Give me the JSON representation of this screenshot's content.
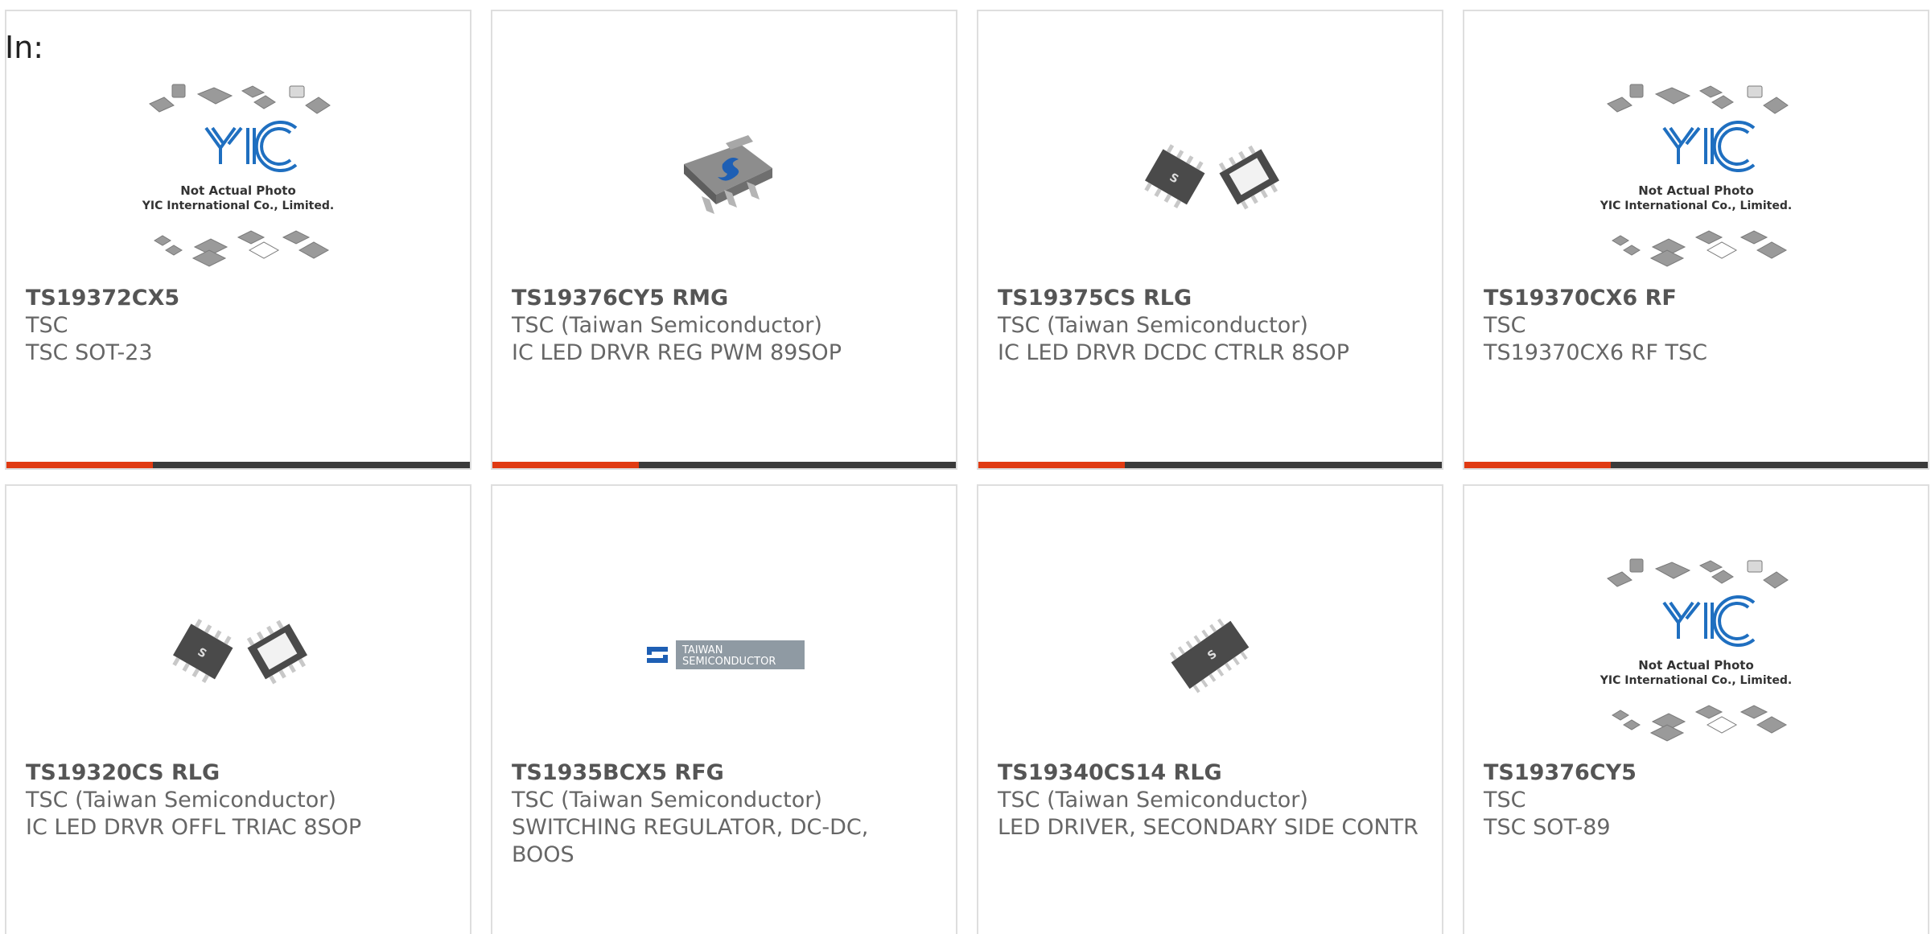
{
  "prefix": "In:",
  "colors": {
    "accent": "#e03a12",
    "bar": "#3a3a3a",
    "border": "#dedede",
    "text": "#666666"
  },
  "placeholder_image": {
    "line1": "Not Actual Photo",
    "line2": "YIC International Co., Limited."
  },
  "products": [
    {
      "part": "TS19372CX5",
      "maker": "TSC",
      "desc": "TSC SOT-23",
      "image": "placeholder",
      "bar": true
    },
    {
      "part": "TS19376CY5 RMG",
      "maker": "TSC (Taiwan Semiconductor)",
      "desc": "IC LED DRVR REG PWM 89SOP",
      "image": "sot89",
      "bar": true
    },
    {
      "part": "TS19375CS RLG",
      "maker": "TSC (Taiwan Semiconductor)",
      "desc": "IC LED DRVR DCDC CTRLR 8SOP",
      "image": "sop8",
      "bar": true
    },
    {
      "part": "TS19370CX6 RF",
      "maker": "TSC",
      "desc": "TS19370CX6 RF TSC",
      "image": "placeholder",
      "bar": true
    },
    {
      "part": "TS19320CS RLG",
      "maker": "TSC (Taiwan Semiconductor)",
      "desc": "IC LED DRVR OFFL TRIAC 8SOP",
      "image": "sop8",
      "bar": false
    },
    {
      "part": "TS1935BCX5 RFG",
      "maker": "TSC (Taiwan Semiconductor)",
      "desc": "SWITCHING REGULATOR, DC-DC, BOOS",
      "image": "logo",
      "bar": false
    },
    {
      "part": "TS19340CS14 RLG",
      "maker": "TSC (Taiwan Semiconductor)",
      "desc": "LED DRIVER, SECONDARY SIDE CONTR",
      "image": "sop14",
      "bar": false
    },
    {
      "part": "TS19376CY5",
      "maker": "TSC",
      "desc": "TSC SOT-89",
      "image": "placeholder",
      "bar": false
    }
  ],
  "logo": {
    "line1": "TAIWAN",
    "line2": "SEMICONDUCTOR"
  }
}
